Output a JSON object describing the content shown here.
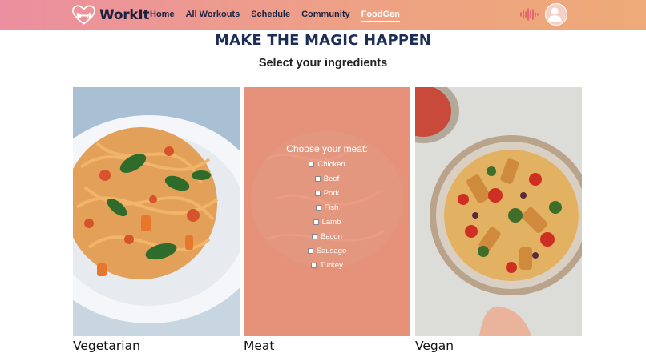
{
  "brand": {
    "name": "WorkIt",
    "logo_icon": "heart-dumbbell-icon"
  },
  "nav": {
    "items": [
      {
        "label": "Home",
        "active": false
      },
      {
        "label": "All Workouts",
        "active": false
      },
      {
        "label": "Schedule",
        "active": false
      },
      {
        "label": "Community",
        "active": false
      },
      {
        "label": "FoodGen",
        "active": true
      }
    ]
  },
  "header_icons": [
    "sound-wave-icon",
    "user-avatar-icon"
  ],
  "page": {
    "title": "MAKE THE MAGIC HAPPEN",
    "subtitle": "Select your ingredients"
  },
  "cards": [
    {
      "label": "Vegetarian",
      "image": "pasta-with-spinach-photo"
    },
    {
      "label": "Meat",
      "image": "pasta-background-photo"
    },
    {
      "label": "Vegan",
      "image": "vegan-pasta-bowl-photo"
    }
  ],
  "meat_form": {
    "question": "Choose your meat:",
    "options": [
      "Chicken",
      "Beef",
      "Pork",
      "Fish",
      "Lamb",
      "Bacon",
      "Sausage",
      "Turkey"
    ]
  },
  "colors": {
    "nav_gradient_start": "#ec8fa0",
    "nav_gradient_end": "#eeaa78",
    "title_color": "#1d2e57",
    "meat_overlay": "#e69179"
  }
}
